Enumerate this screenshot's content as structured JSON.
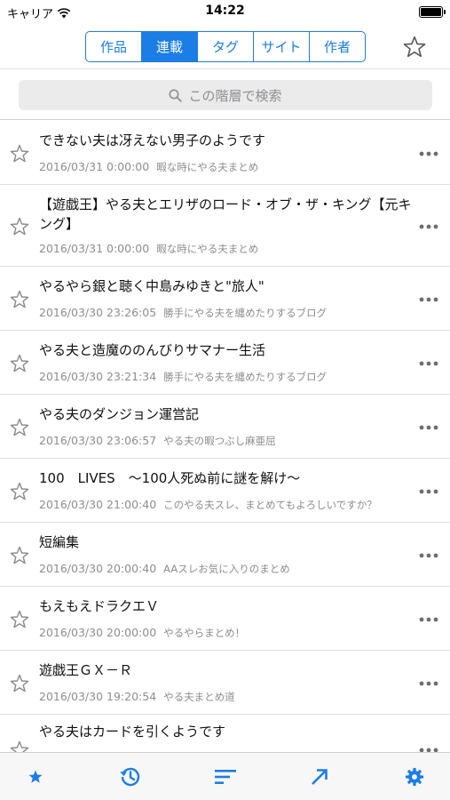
{
  "status": {
    "carrier": "キャリア",
    "time": "14:22",
    "battery_level": 1.0
  },
  "nav": {
    "segments": [
      {
        "label": "作品",
        "active": false
      },
      {
        "label": "連載",
        "active": true
      },
      {
        "label": "タグ",
        "active": false
      },
      {
        "label": "サイト",
        "active": false
      },
      {
        "label": "作者",
        "active": false
      }
    ],
    "right_icon": "star-outline-icon"
  },
  "search": {
    "placeholder": "この階層で検索",
    "icon": "search-icon"
  },
  "items": [
    {
      "title": "できない夫は冴えない男子のようです",
      "date": "2016/03/31 0:00:00",
      "site": "暇な時にやる夫まとめ"
    },
    {
      "title": "【遊戯王】やる夫とエリザのロード・オブ・ザ・キング【元キング】",
      "date": "2016/03/31 0:00:00",
      "site": "暇な時にやる夫まとめ"
    },
    {
      "title": "やるやら銀と聴く中島みゆきと\"旅人\"",
      "date": "2016/03/30 23:26:05",
      "site": "勝手にやる夫を纏めたりするブログ"
    },
    {
      "title": "やる夫と造魔ののんびりサマナー生活",
      "date": "2016/03/30 23:21:34",
      "site": "勝手にやる夫を纏めたりするブログ"
    },
    {
      "title": "やる夫のダンジョン運営記",
      "date": "2016/03/30 23:06:57",
      "site": "やる夫の暇つぶし麻亜屈"
    },
    {
      "title": "100　LIVES　～100人死ぬ前に謎を解け～",
      "date": "2016/03/30 21:00:40",
      "site": "このやる夫スレ、まとめてもよろしいですか？"
    },
    {
      "title": "短編集",
      "date": "2016/03/30 20:00:40",
      "site": "AAスレお気に入りのまとめ"
    },
    {
      "title": "もえもえドラクエＶ",
      "date": "2016/03/30 20:00:00",
      "site": "やるやらまとめ！"
    },
    {
      "title": "遊戯王ＧＸ－Ｒ",
      "date": "2016/03/30 19:20:54",
      "site": "やる夫まとめ道"
    },
    {
      "title": "やる夫はカードを引くようです",
      "date": "",
      "site": ""
    }
  ],
  "tabbar": [
    {
      "icon": "favorites-star-icon",
      "name": "tab-favorites"
    },
    {
      "icon": "history-icon",
      "name": "tab-history"
    },
    {
      "icon": "sort-icon",
      "name": "tab-sort"
    },
    {
      "icon": "open-arrow-icon",
      "name": "tab-open"
    },
    {
      "icon": "gear-icon",
      "name": "tab-settings"
    }
  ],
  "colors": {
    "accent": "#1b7de6",
    "star_outline": "#8a8a8a",
    "meta_text": "#8e8e8e"
  }
}
